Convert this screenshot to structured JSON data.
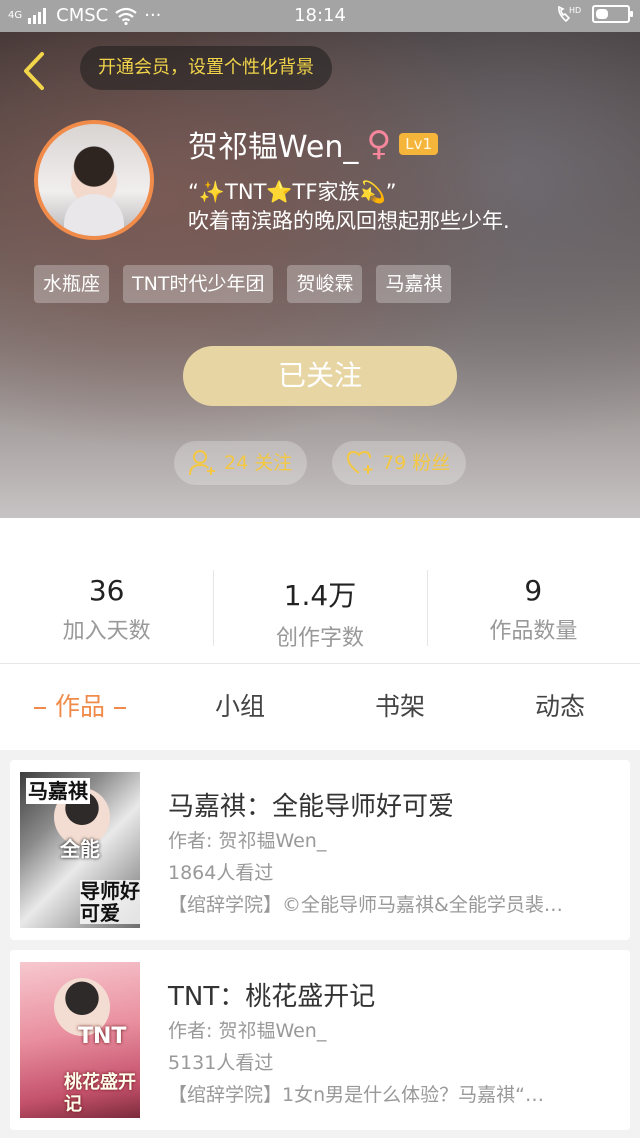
{
  "status_bar": {
    "signal": "4G",
    "carrier": "CMSC",
    "more": "···",
    "time": "18:14",
    "hd_label": "HD",
    "battery_level": 0.3
  },
  "header": {
    "promo_text": "开通会员，设置个性化背景",
    "username": "贺祁韫Wen_",
    "gender_symbol": "♀",
    "level": "Lv1",
    "bio_line1": "“✨TNT⭐TF家族💫”",
    "bio_line2": "吹着南滨路的晚风回想起那些少年.",
    "tags": [
      "水瓶座",
      "TNT时代少年团",
      "贺峻霖",
      "马嘉祺"
    ],
    "follow_button": "已关注",
    "following_count": "24 关注",
    "fans_count": "79 粉丝"
  },
  "stats": [
    {
      "value": "36",
      "label": "加入天数"
    },
    {
      "value": "1.4万",
      "label": "创作字数"
    },
    {
      "value": "9",
      "label": "作品数量"
    }
  ],
  "tabs": [
    "作品",
    "小组",
    "书架",
    "动态"
  ],
  "works": [
    {
      "title": "马嘉祺：全能导师好可爱",
      "author": "作者: 贺祁韫Wen_",
      "views": "1864人看过",
      "description": "【绾辞学院】©全能导师马嘉祺&全能学员裴…",
      "cover_text": [
        "马嘉祺",
        "全能",
        "导师好可爱"
      ]
    },
    {
      "title": "TNT：桃花盛开记",
      "author": "作者: 贺祁韫Wen_",
      "views": "5131人看过",
      "description": "【绾辞学院】1女n男是什么体验？马嘉祺“…",
      "cover_text": [
        "TNT",
        "桃花盛开记"
      ]
    }
  ],
  "colors": {
    "accent_orange": "#f08b4a",
    "gold": "#f4c843",
    "follow_button": "#e7d6a4"
  }
}
